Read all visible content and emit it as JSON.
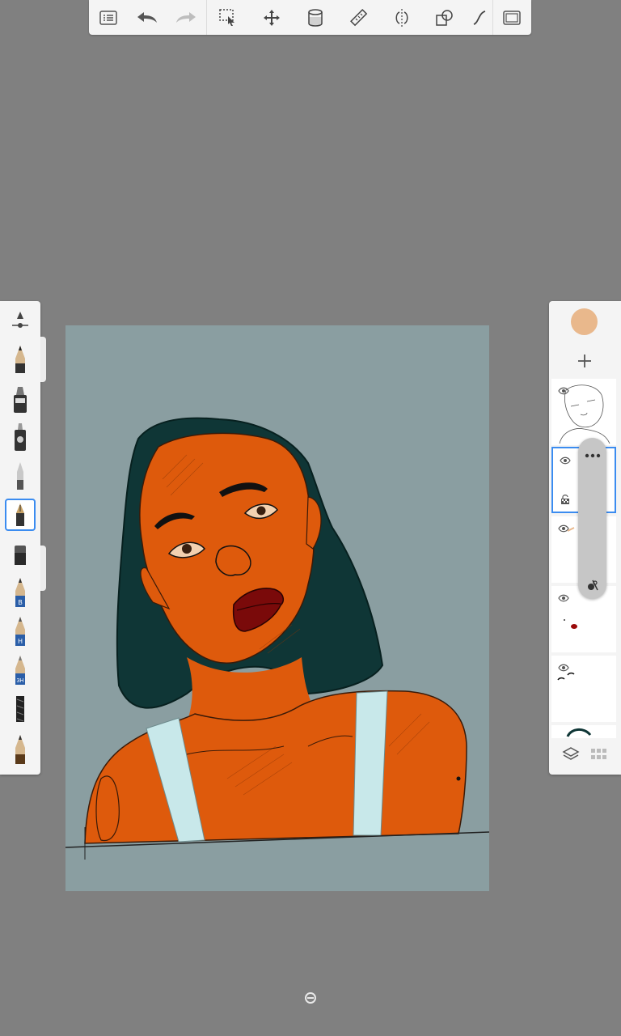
{
  "app": "Sketchbook",
  "toolbar": {
    "items": [
      "menu-icon",
      "undo-icon",
      "redo-icon",
      "selection-icon",
      "transform-icon",
      "fill-icon",
      "ruler-icon",
      "symmetry-icon",
      "shapes-icon",
      "curve-icon",
      "fullscreen-icon"
    ]
  },
  "brush_palette": {
    "selected_index": 4,
    "brushes": [
      {
        "name": "pencil",
        "label": ""
      },
      {
        "name": "marker",
        "label": ""
      },
      {
        "name": "airbrush",
        "label": ""
      },
      {
        "name": "ballpoint",
        "label": ""
      },
      {
        "name": "ink-pen",
        "label": ""
      },
      {
        "name": "eraser",
        "label": ""
      },
      {
        "name": "pencil-b",
        "label": "B"
      },
      {
        "name": "pencil-h",
        "label": "H"
      },
      {
        "name": "pencil-3h",
        "label": "3H"
      },
      {
        "name": "chalk",
        "label": ""
      },
      {
        "name": "pencil-2",
        "label": ""
      }
    ]
  },
  "layers_panel": {
    "current_color": "#e9b88c",
    "layers": [
      {
        "name": "sketch-layer",
        "visible": true,
        "active": false
      },
      {
        "name": "active-layer",
        "visible": true,
        "active": true,
        "locked_icon": true
      },
      {
        "name": "skin-layer",
        "visible": true,
        "active": false
      },
      {
        "name": "lips-layer",
        "visible": true,
        "active": false
      },
      {
        "name": "eyes-layer",
        "visible": true,
        "active": false
      },
      {
        "name": "hair-layer",
        "visible": true,
        "active": false
      }
    ]
  },
  "colors": {
    "background": "#808080",
    "canvas_bg": "#8a9ea1",
    "hair": "#0f3636",
    "skin": "#de5a0c",
    "straps": "#c8e8ea",
    "lips": "#7a0a0a",
    "accent": "#3b8cf0"
  }
}
